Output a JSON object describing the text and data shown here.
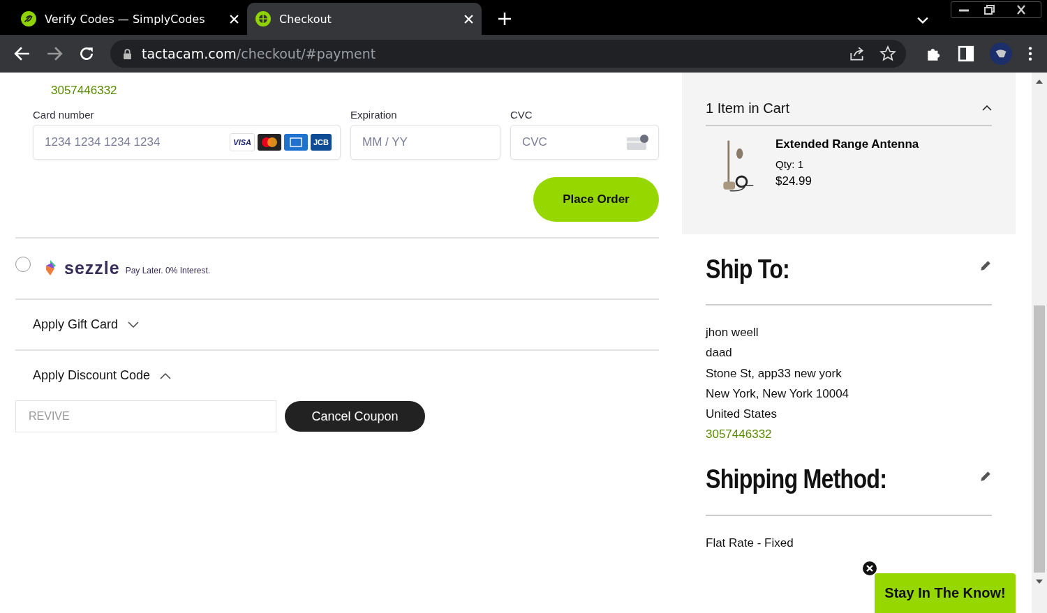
{
  "browser": {
    "tabs": [
      {
        "title": "Verify Codes — SimplyCodes",
        "selected": false,
        "kind": "leaf"
      },
      {
        "title": "Checkout",
        "selected": true,
        "kind": "target"
      }
    ],
    "url": {
      "host": "tactacam.com",
      "path": "/checkout/#payment"
    }
  },
  "payment": {
    "phone": "3057446332",
    "fields": [
      {
        "label": "Card number",
        "placeholder": "1234 1234 1234 1234",
        "kind": "card"
      },
      {
        "label": "Expiration",
        "placeholder": "MM / YY",
        "kind": "plain"
      },
      {
        "label": "CVC",
        "placeholder": "CVC",
        "kind": "cvc"
      }
    ],
    "card_brands": [
      {
        "kind": "visa",
        "label": "VISA"
      },
      {
        "kind": "mastercard"
      },
      {
        "kind": "amex"
      },
      {
        "kind": "jcb",
        "label": "JCB"
      }
    ],
    "place_order": "Place Order",
    "sezzle": {
      "selected": false,
      "name": "sezzle",
      "tagline": "Pay Later. 0% Interest."
    },
    "sections": [
      {
        "label": "Apply Gift Card",
        "expanded": false
      },
      {
        "label": "Apply Discount Code",
        "expanded": true
      }
    ],
    "discount": {
      "value": "REVIVE",
      "disabled": true,
      "button": "Cancel Coupon"
    }
  },
  "summary": {
    "cart": {
      "title": "1 Item in Cart",
      "expanded": true,
      "items": [
        {
          "name": "Extended Range Antenna",
          "qty": "Qty: 1",
          "price": "$24.99"
        }
      ]
    },
    "ship_to": {
      "heading": "Ship To:",
      "lines": [
        "jhon weell",
        "daad",
        "Stone St, app33 new york",
        "New York, New York 10004",
        "United States"
      ],
      "phone": "3057446332"
    },
    "shipping_method": {
      "heading": "Shipping Method:",
      "value": "Flat Rate - Fixed"
    }
  },
  "popup": {
    "label": "Stay In The Know!"
  }
}
